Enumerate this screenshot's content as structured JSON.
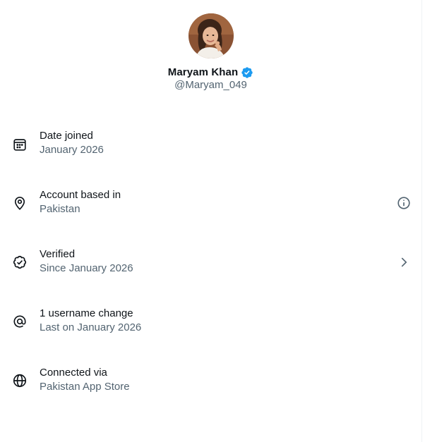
{
  "profile": {
    "display_name": "Maryam Khan",
    "handle": "@Maryam_049",
    "verified": true,
    "badge_color": "#1d9bf0",
    "avatar_icon": "profile-photo"
  },
  "about_items": [
    {
      "icon": "calendar-icon",
      "title": "Date joined",
      "subtitle": "January 2026",
      "trailing": null
    },
    {
      "icon": "location-pin-icon",
      "title": "Account based in",
      "subtitle": "Pakistan",
      "trailing": "info-icon"
    },
    {
      "icon": "verified-check-icon",
      "title": "Verified",
      "subtitle": "Since January 2026",
      "trailing": "chevron-right-icon"
    },
    {
      "icon": "at-sign-icon",
      "title": "1 username change",
      "subtitle": "Last on January 2026",
      "trailing": null
    },
    {
      "icon": "globe-icon",
      "title": "Connected via",
      "subtitle": "Pakistan App Store",
      "trailing": null
    }
  ],
  "colors": {
    "text_primary": "#0f1419",
    "text_secondary": "#536471",
    "accent": "#1d9bf0",
    "background": "#ffffff"
  }
}
